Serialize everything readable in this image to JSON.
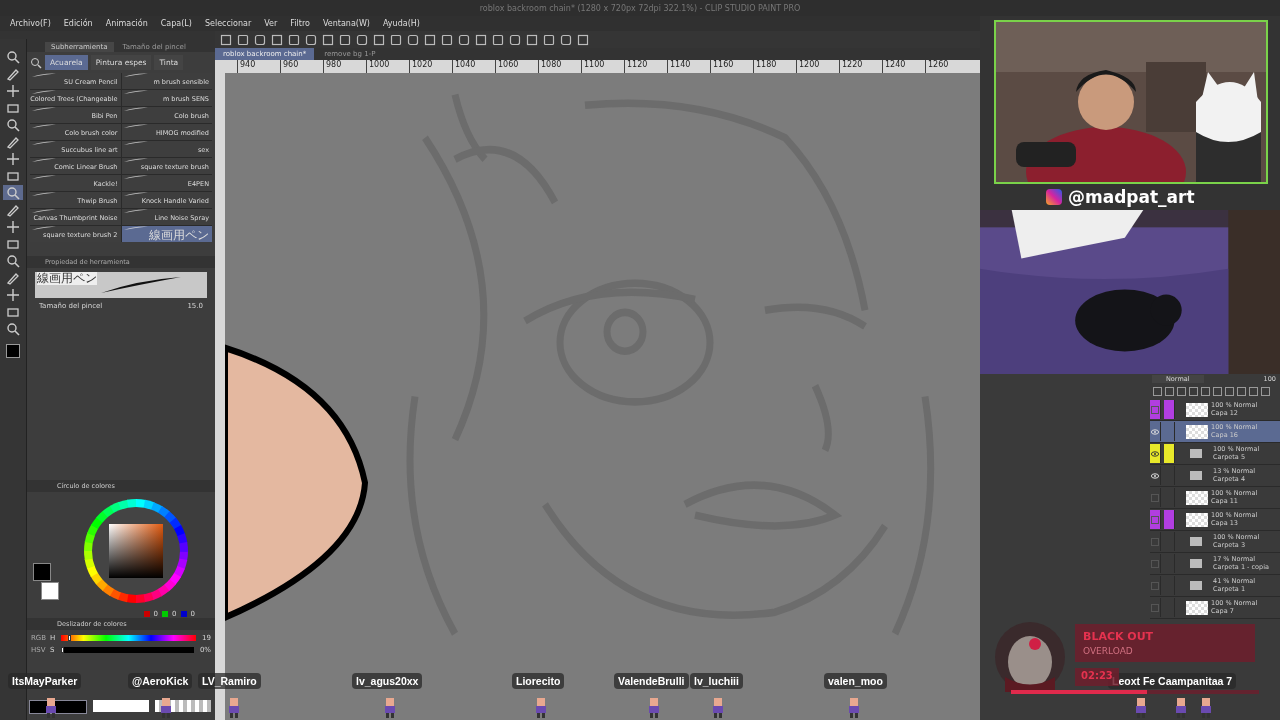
{
  "window": {
    "title": "roblox backroom chain* (1280 x 720px 72dpi 322.1%) - CLIP STUDIO PAINT PRO"
  },
  "menu": [
    "Archivo(F)",
    "Edición",
    "Animación",
    "Capa(L)",
    "Seleccionar",
    "Ver",
    "Filtro",
    "Ventana(W)",
    "Ayuda(H)"
  ],
  "documents": [
    {
      "label": "roblox backroom chain*",
      "selected": true
    },
    {
      "label": "remove bg 1-P",
      "selected": false
    }
  ],
  "ruler": [
    "940",
    "960",
    "980",
    "1000",
    "1020",
    "1040",
    "1060",
    "1080",
    "1100",
    "1120",
    "1140",
    "1160",
    "1180",
    "1200",
    "1220",
    "1240",
    "1260"
  ],
  "tools": [
    {
      "selected": false
    },
    {
      "selected": false
    },
    {
      "selected": false
    },
    {
      "selected": false
    },
    {
      "selected": false
    },
    {
      "selected": false
    },
    {
      "selected": false
    },
    {
      "selected": false
    },
    {
      "selected": true
    },
    {
      "selected": false
    },
    {
      "selected": false
    },
    {
      "selected": false
    },
    {
      "selected": false
    },
    {
      "selected": false
    },
    {
      "selected": false
    },
    {
      "selected": false
    },
    {
      "selected": false
    }
  ],
  "subtool_panel": {
    "tabs": [
      {
        "label": "Subherramienta",
        "selected": true
      },
      {
        "label": "Tamaño del pincel",
        "selected": false
      }
    ],
    "groups": [
      {
        "label": "Acuarela",
        "selected": true
      },
      {
        "label": "Pintura espes",
        "selected": false
      },
      {
        "label": "Tinta",
        "selected": false
      }
    ],
    "brushes": [
      {
        "name": "SU Cream Pencil",
        "selected": false
      },
      {
        "name": "m brush sensible",
        "selected": false
      },
      {
        "name": "Colored Trees (Changeable",
        "selected": false
      },
      {
        "name": "m brush SENS",
        "selected": false
      },
      {
        "name": "Bibi Pen",
        "selected": false
      },
      {
        "name": "Colo brush",
        "selected": false
      },
      {
        "name": "Colo brush color",
        "selected": false
      },
      {
        "name": "HIMOG modified",
        "selected": false
      },
      {
        "name": "Succubus line art",
        "selected": false
      },
      {
        "name": "sex",
        "selected": false
      },
      {
        "name": "Comic Linear Brush",
        "selected": false
      },
      {
        "name": "square texture brush",
        "selected": false
      },
      {
        "name": "Kackle!",
        "selected": false
      },
      {
        "name": "E4PEN",
        "selected": false
      },
      {
        "name": "Thwip Brush",
        "selected": false
      },
      {
        "name": "Knock Handle Varied",
        "selected": false
      },
      {
        "name": "Canvas Thumbprint Noise",
        "selected": false
      },
      {
        "name": "Line Noise Spray",
        "selected": false
      },
      {
        "name": "square texture brush 2",
        "selected": false
      },
      {
        "name": "線画用ペン",
        "selected": true
      }
    ]
  },
  "tool_property": {
    "title": "Propiedad de herramienta",
    "preview_label": "線画用ペン",
    "size_label": "Tamaño del pincel",
    "size_value": "15.0"
  },
  "color_wheel": {
    "title": "Círculo de colores",
    "r": "0",
    "g": "0",
    "b": "0"
  },
  "color_slider": {
    "title": "Deslizador de colores",
    "modes": [
      "RGB",
      "HSV"
    ],
    "h": {
      "label": "H",
      "value": "19",
      "level": 0.05
    },
    "s": {
      "label": "S",
      "value": "0%",
      "level": 0
    }
  },
  "stream": {
    "handle": "@madpat_art"
  },
  "layers_panel": {
    "blend": "Normal",
    "opacity": "100",
    "layers": [
      {
        "opacity": "100 % Normal",
        "name": "Capa 12",
        "kind": "layer",
        "visible": false,
        "color": "#b13ee0",
        "selected": false
      },
      {
        "opacity": "100 % Normal",
        "name": "Capa 16",
        "kind": "layer",
        "visible": true,
        "selected": true
      },
      {
        "opacity": "100 % Normal",
        "name": "Carpeta 5",
        "kind": "folder",
        "visible": true,
        "color": "#e8e82a",
        "selected": false
      },
      {
        "opacity": "13 % Normal",
        "name": "Carpeta 4",
        "kind": "folder",
        "visible": true,
        "selected": false
      },
      {
        "opacity": "100 % Normal",
        "name": "Capa 11",
        "kind": "layer",
        "visible": false,
        "selected": false
      },
      {
        "opacity": "100 % Normal",
        "name": "Capa 13",
        "kind": "layer",
        "visible": false,
        "color": "#b13ee0",
        "selected": false
      },
      {
        "opacity": "100 % Normal",
        "name": "Carpeta 3",
        "kind": "folder",
        "visible": false,
        "selected": false
      },
      {
        "opacity": "17 % Normal",
        "name": "Carpeta 1 - copia",
        "kind": "folder",
        "visible": false,
        "selected": false
      },
      {
        "opacity": "41 % Normal",
        "name": "Carpeta 1",
        "kind": "folder",
        "visible": false,
        "selected": false
      },
      {
        "opacity": "100 % Normal",
        "name": "Capa 7",
        "kind": "layer",
        "visible": false,
        "selected": false
      }
    ]
  },
  "music": {
    "title": "BLACK OUT",
    "artist": "OVERLOAD",
    "time": "02:23",
    "level": 0.55
  },
  "chatters": [
    "ItsMayParker",
    "@AeroKick",
    "LV_Ramiro",
    "lv_agus20xx",
    "Liorecito",
    "ValendeBrulli",
    "lv_luchiii",
    "valen_moo",
    "Leoxt Fe Caampanitaa 7"
  ]
}
